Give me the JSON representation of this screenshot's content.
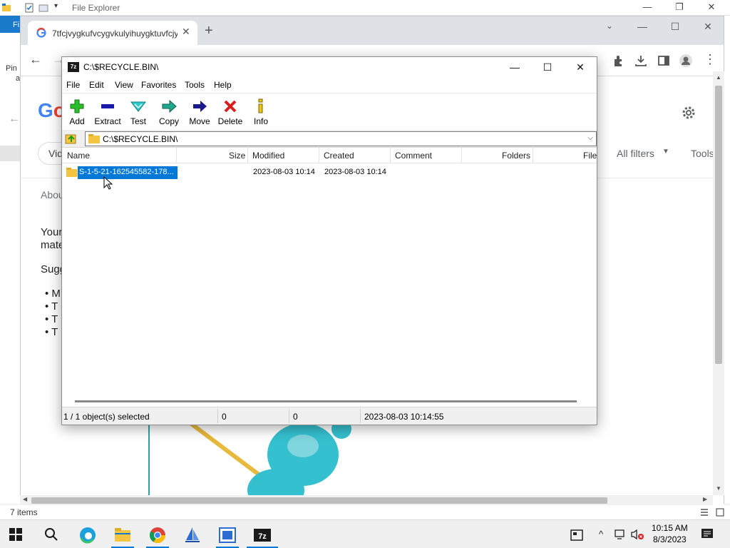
{
  "file_explorer": {
    "title": "File Explorer",
    "ribbon_tab": "Fi",
    "left_pane_text": [
      "Pin",
      "a"
    ],
    "status_text": "7 items"
  },
  "chrome": {
    "tab_title": "7tfcjvygkufvcygvkulyihuygktuvfcjyg",
    "page": {
      "about": "Abou",
      "your": "Your",
      "match": "mate",
      "suggestions": "Sugg",
      "bullets": [
        "M",
        "T",
        "T",
        "T"
      ],
      "vid_chip": "Vid",
      "all_filters": "All filters",
      "tools": "Tools"
    }
  },
  "zip": {
    "title": "C:\\$RECYCLE.BIN\\",
    "menu": [
      "File",
      "Edit",
      "View",
      "Favorites",
      "Tools",
      "Help"
    ],
    "toolbar": [
      {
        "label": "Add",
        "icon": "add-icon"
      },
      {
        "label": "Extract",
        "icon": "extract-icon"
      },
      {
        "label": "Test",
        "icon": "test-icon"
      },
      {
        "label": "Copy",
        "icon": "copy-icon"
      },
      {
        "label": "Move",
        "icon": "move-icon"
      },
      {
        "label": "Delete",
        "icon": "delete-icon"
      },
      {
        "label": "Info",
        "icon": "info-icon"
      }
    ],
    "address": "C:\\$RECYCLE.BIN\\",
    "columns": [
      "Name",
      "Size",
      "Modified",
      "Created",
      "Comment",
      "Folders",
      "File"
    ],
    "rows": [
      {
        "name": "S-1-5-21-162545582-178...",
        "size": "",
        "modified": "2023-08-03 10:14",
        "created": "2023-08-03 10:14"
      }
    ],
    "status": {
      "selected": "1 / 1 object(s) selected",
      "size": "0",
      "packed": "0",
      "date": "2023-08-03 10:14:55"
    }
  },
  "taskbar": {
    "time": "10:15 AM",
    "date": "8/3/2023"
  },
  "colors": {
    "selection": "#0078d7",
    "chrome_tab_strip": "#dee1e6",
    "folder_yellow": "#f5c542"
  }
}
